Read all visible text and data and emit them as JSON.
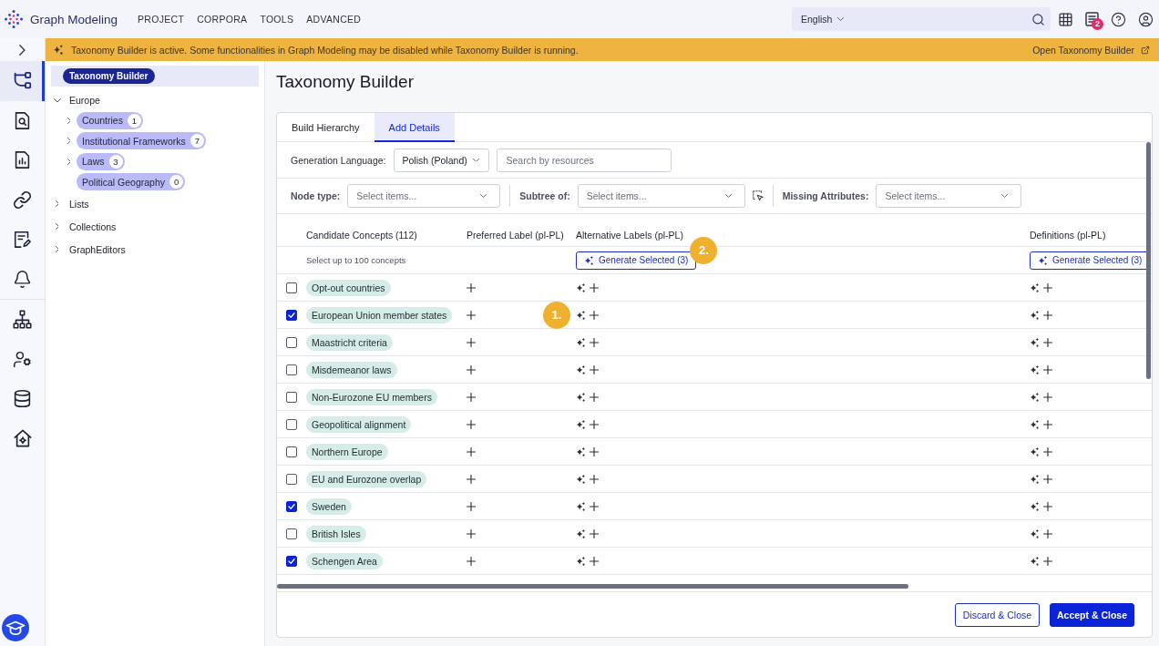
{
  "app": {
    "name": "Graph Modeling",
    "menu": [
      "PROJECT",
      "CORPORA",
      "TOOLS",
      "ADVANCED"
    ],
    "language": "English",
    "notifications": "2"
  },
  "rail": {
    "groups": [
      {
        "items": [
          {
            "kind": "hierarchy",
            "selected": true
          },
          {
            "kind": "document_search",
            "selected": false
          },
          {
            "kind": "document_chart",
            "selected": false
          },
          {
            "kind": "link",
            "selected": false
          },
          {
            "kind": "document_edit",
            "selected": false
          },
          {
            "kind": "bell",
            "selected": false
          }
        ]
      },
      {
        "items": [
          {
            "kind": "sitemap",
            "selected": false
          },
          {
            "kind": "user_settings",
            "selected": false
          },
          {
            "kind": "database",
            "selected": false
          },
          {
            "kind": "home_settings",
            "selected": false
          }
        ]
      }
    ]
  },
  "banner": {
    "message": "Taxonomy Builder is active. Some functionalities in Graph Modeling may be disabled while Taxonomy Builder is running.",
    "link": "Open Taxonomy Builder"
  },
  "tree": {
    "pinned": {
      "label": "Taxonomy Builder",
      "selected": true
    },
    "items": [
      {
        "label": "Europe",
        "expandable": true,
        "expanded": true,
        "children": [
          {
            "label": "Countries",
            "count": "1",
            "expandable": true,
            "expanded": false
          },
          {
            "label": "Institutional Frameworks",
            "count": "7",
            "expandable": true,
            "expanded": false
          },
          {
            "label": "Laws",
            "count": "3",
            "expandable": true,
            "expanded": false
          },
          {
            "label": "Political Geography",
            "count": "0",
            "expandable": false
          }
        ]
      },
      {
        "label": "Lists",
        "expandable": true,
        "expanded": false
      },
      {
        "label": "Collections",
        "expandable": true,
        "expanded": false
      },
      {
        "label": "GraphEditors",
        "expandable": true,
        "expanded": false
      }
    ]
  },
  "page": {
    "title": "Taxonomy Builder"
  },
  "tabs": [
    {
      "label": "Build Hierarchy",
      "selected": false
    },
    {
      "label": "Add Details",
      "selected": true
    }
  ],
  "generation": {
    "label": "Generation Language:",
    "value": "Polish (Poland)",
    "search": {
      "placeholder": "Search by resources"
    }
  },
  "filters": [
    {
      "label": "Node type:",
      "placeholder": "Select items...",
      "picker": false
    },
    {
      "label": "Subtree of:",
      "placeholder": "Select items...",
      "picker": true
    },
    {
      "label": "Missing Attributes:",
      "placeholder": "Select items...",
      "picker": false
    }
  ],
  "table": {
    "columns": [
      {
        "label": "Candidate Concepts (112)",
        "kind": "concept",
        "note": "Select up to 100 concepts"
      },
      {
        "label": "Preferred Label (pl-PL)",
        "kind": "add"
      },
      {
        "label": "Alternative Labels (pl-PL)",
        "kind": "generate",
        "action": "Generate Selected (3)",
        "callout": "2."
      },
      {
        "label": "Definitions (pl-PL)",
        "kind": "generate",
        "action": "Generate Selected (3)"
      }
    ],
    "rows": [
      {
        "concept": "Opt-out countries",
        "checked": false
      },
      {
        "concept": "European Union member states",
        "checked": true,
        "callout": "1."
      },
      {
        "concept": "Maastricht criteria",
        "checked": false
      },
      {
        "concept": "Misdemeanor laws",
        "checked": false
      },
      {
        "concept": "Non-Eurozone EU members",
        "checked": false
      },
      {
        "concept": "Geopolitical alignment",
        "checked": false
      },
      {
        "concept": "Northern Europe",
        "checked": false
      },
      {
        "concept": "EU and Eurozone overlap",
        "checked": false
      },
      {
        "concept": "Sweden",
        "checked": true
      },
      {
        "concept": "British Isles",
        "checked": false
      },
      {
        "concept": "Schengen Area",
        "checked": true
      }
    ]
  },
  "footer": {
    "buttons": [
      {
        "label": "Discard & Close",
        "kind": "secondary"
      },
      {
        "label": "Accept & Close",
        "kind": "primary"
      }
    ]
  }
}
